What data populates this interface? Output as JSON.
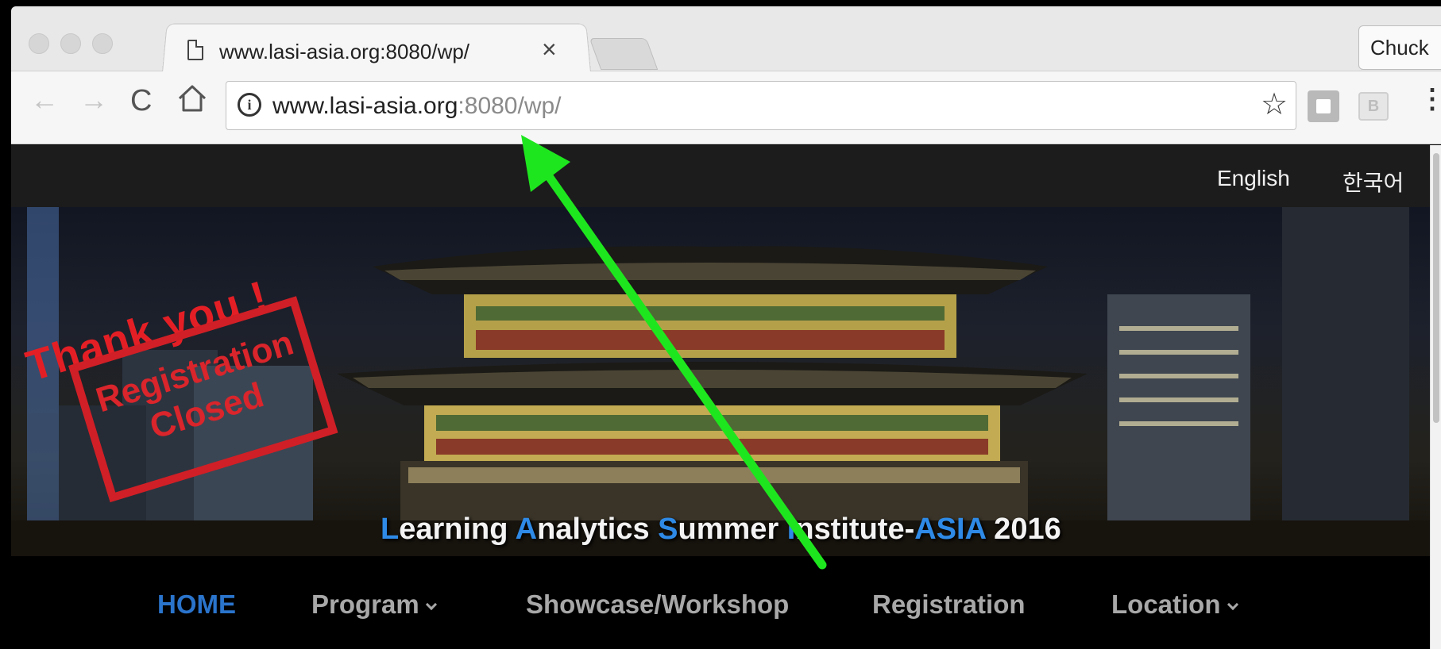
{
  "browser": {
    "tab": {
      "title": "www.lasi-asia.org:8080/wp/",
      "close_glyph": "×",
      "icon": "page-icon"
    },
    "profile_name": "Chuck",
    "toolbar": {
      "back_glyph": "←",
      "forward_glyph": "→",
      "reload_glyph": "C",
      "info_glyph": "i",
      "star_glyph": "☆",
      "menu_glyph": "⋮",
      "ext2_label": "B"
    },
    "address": {
      "host": "www.lasi-asia.org",
      "rest": ":8080/wp/"
    }
  },
  "page": {
    "languages": {
      "english": "English",
      "korean": "한국어"
    },
    "banner": {
      "stamp_thanks": "Thank you !",
      "stamp_line1": "Registration",
      "stamp_line2": "Closed",
      "title": {
        "p1": "L",
        "p2": "earning ",
        "p3": "A",
        "p4": "nalytics ",
        "p5": "S",
        "p6": "ummer ",
        "p7": "I",
        "p8": "nstitute-",
        "p9": "ASIA",
        "p10": " 2016"
      }
    },
    "nav": {
      "home": "HOME",
      "program": "Program",
      "showcase": "Showcase/Workshop",
      "registration": "Registration",
      "location": "Location"
    }
  },
  "colors": {
    "annotation_arrow": "#1ee61e",
    "nav_active": "#2a74cc",
    "title_accent": "#2e8ae6",
    "stamp_red": "#d9252b"
  }
}
